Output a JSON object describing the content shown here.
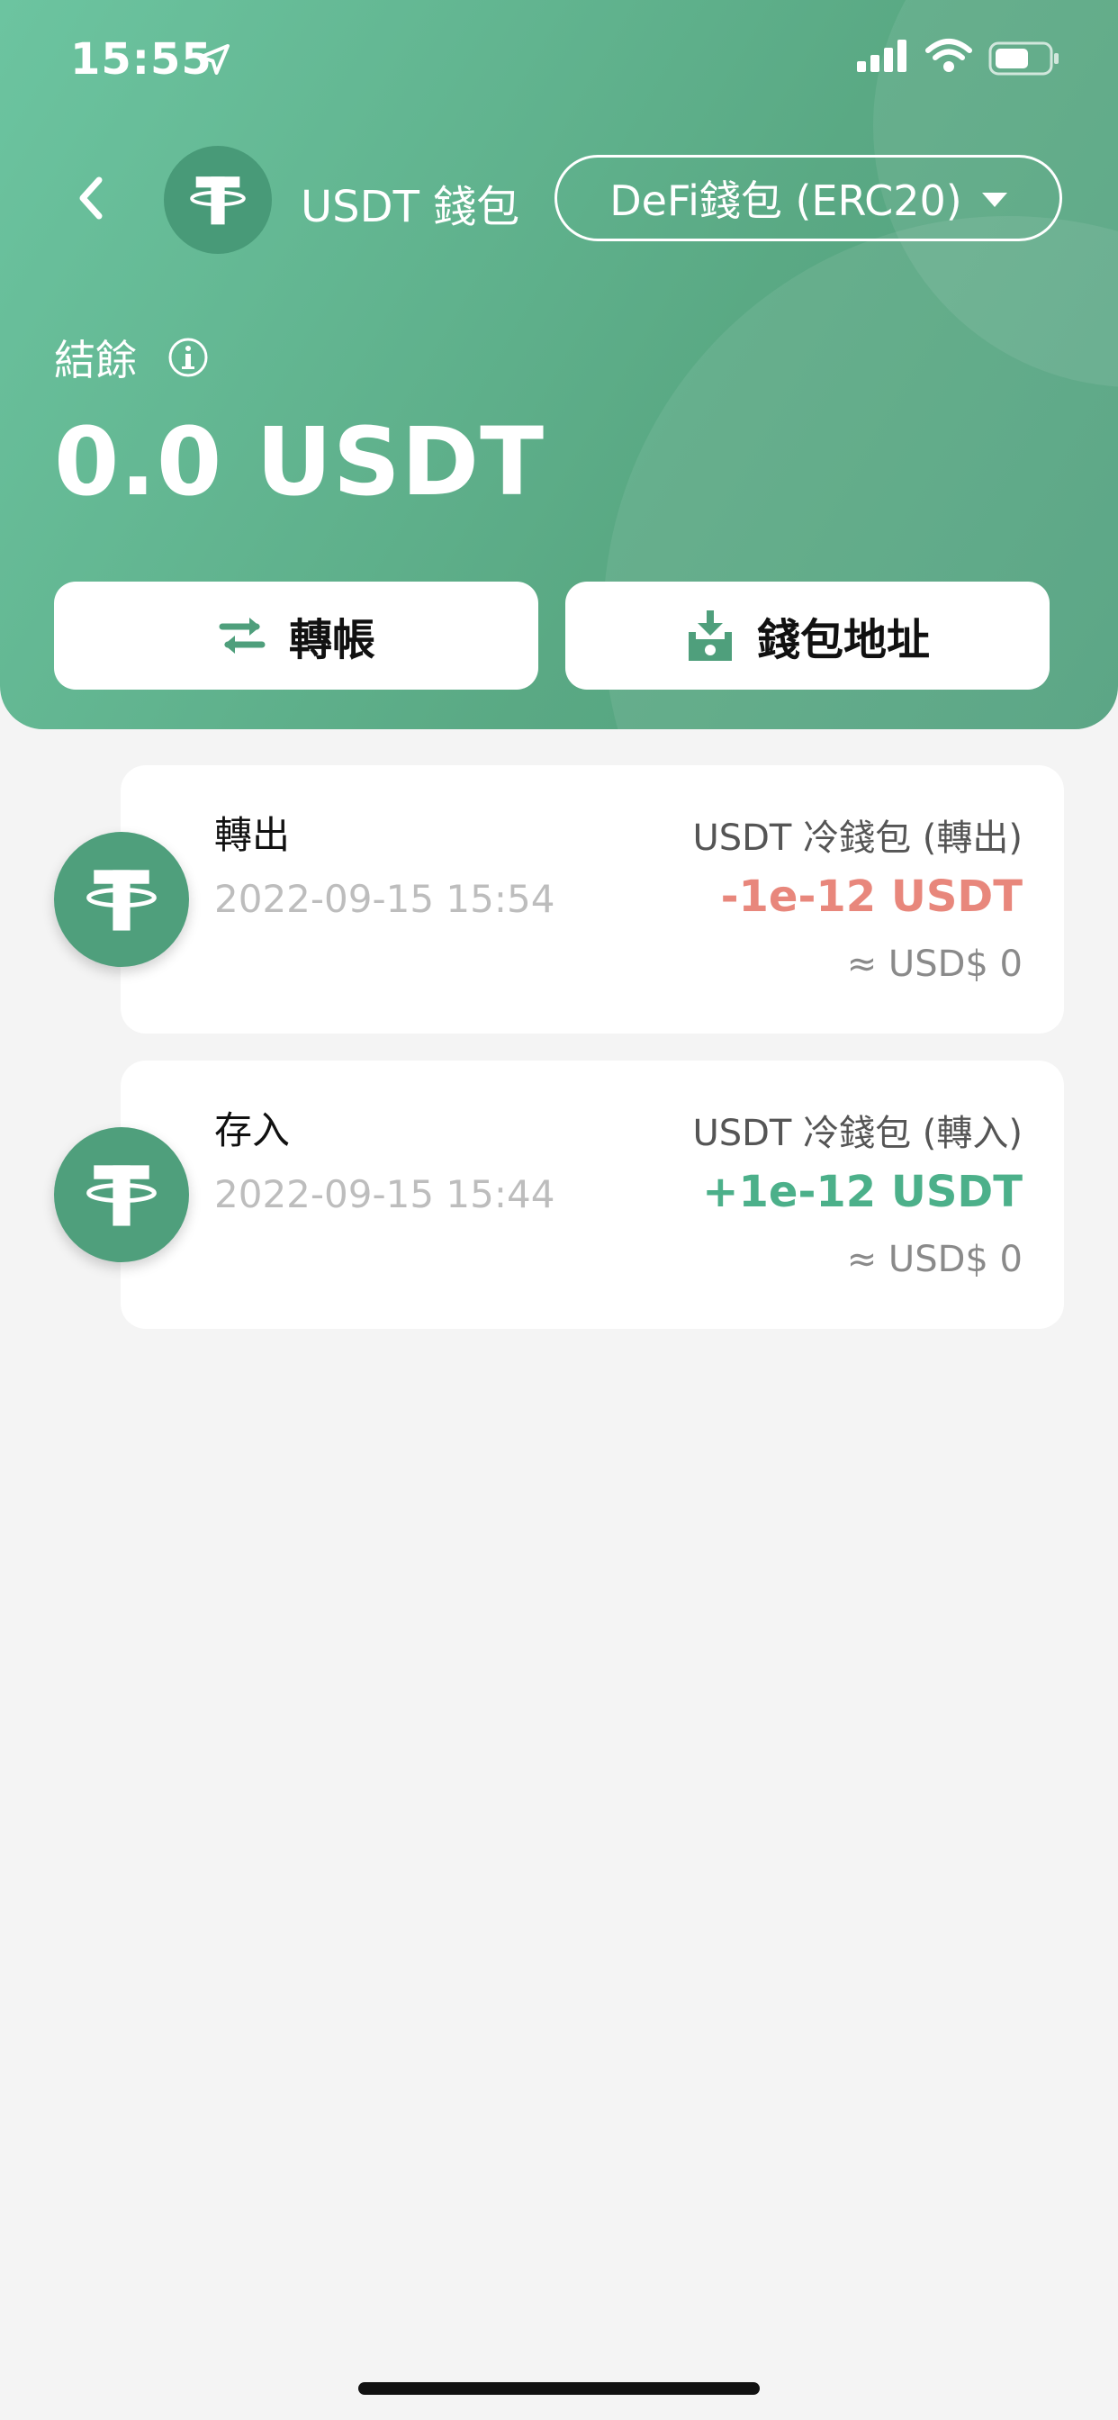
{
  "status_bar": {
    "time": "15:55"
  },
  "header": {
    "wallet_title": "USDT 錢包",
    "wallet_selector": "DeFi錢包 (ERC20)",
    "balance_label": "結餘",
    "balance_value": "0.0 USDT",
    "gradient_colors": [
      "#6cc4a0",
      "#4f9f7c"
    ]
  },
  "actions": {
    "transfer_label": "轉帳",
    "address_label": "錢包地址"
  },
  "transactions": [
    {
      "type": "轉出",
      "date": "2022-09-15 15:54",
      "wallet": "USDT 冷錢包 (轉出)",
      "amount": "-1e-12 USDT",
      "usd": "≈ USD$ 0",
      "amount_color": "#e8877c"
    },
    {
      "type": "存入",
      "date": "2022-09-15 15:44",
      "wallet": "USDT 冷錢包 (轉入)",
      "amount": "+1e-12 USDT",
      "usd": "≈ USD$ 0",
      "amount_color": "#4cb08a"
    }
  ],
  "icons": {
    "status_arrow": "location-arrow-icon",
    "signal": "cellular-signal-icon",
    "wifi": "wifi-icon",
    "battery": "battery-icon",
    "back": "chevron-left-icon",
    "coin": "tether-logo-icon",
    "info": "info-icon",
    "transfer": "swap-arrows-icon",
    "address": "download-tray-icon"
  }
}
